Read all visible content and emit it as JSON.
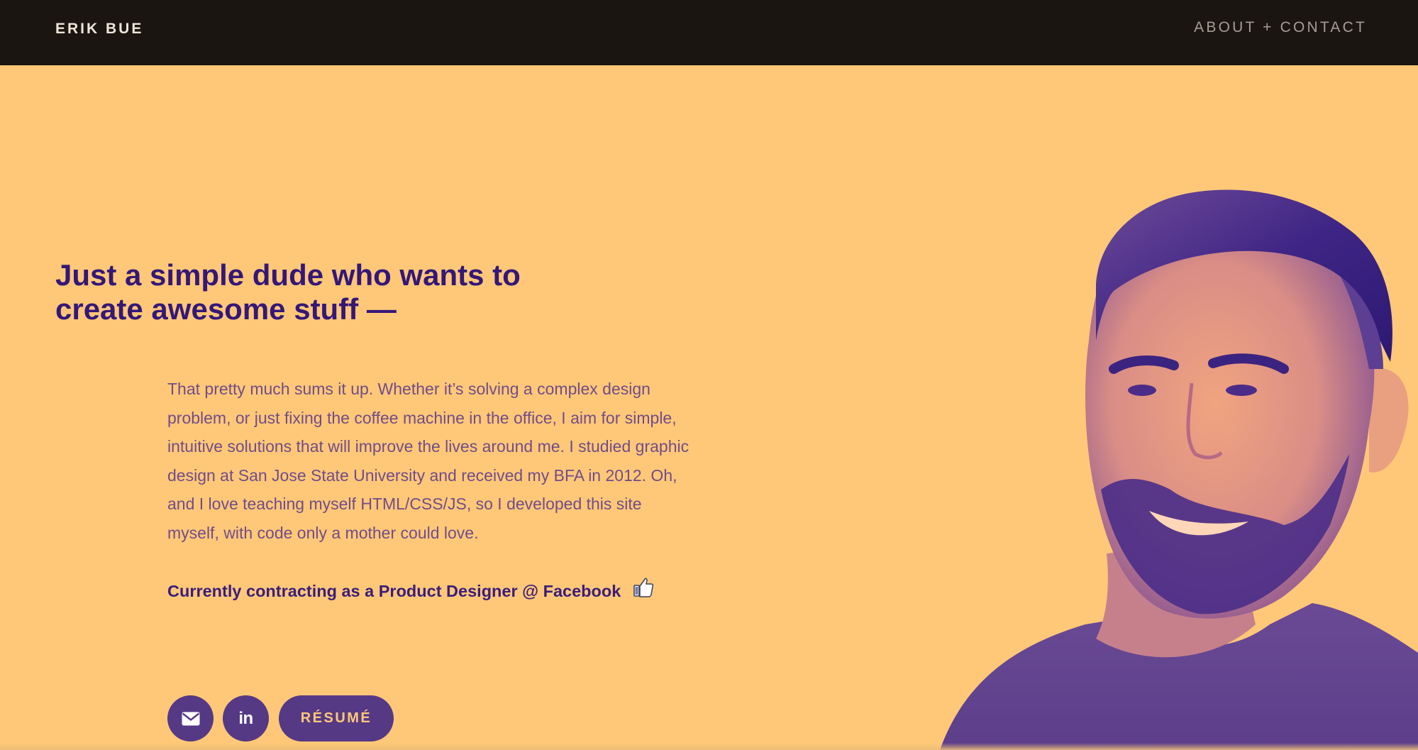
{
  "header": {
    "brand": "ERIK BUE",
    "nav_link": "ABOUT + CONTACT"
  },
  "hero": {
    "headline_line1": "Just a simple dude who wants to",
    "headline_line2": "create awesome stuff —",
    "bio": "That pretty much sums it up. Whether it’s solving a complex design problem, or just fixing the coffee machine in the office, I aim for simple, intuitive solutions that will improve the lives around me. I studied graphic design at San Jose State University and received my BFA in 2012. Oh, and I love teaching myself HTML/CSS/JS, so I developed this site myself, with code only a mother could love.",
    "status": "Currently contracting as a Product Designer @ Facebook",
    "status_icon": "thumbs-up-icon"
  },
  "actions": {
    "email_icon": "envelope-icon",
    "linkedin_icon": "linkedin-icon",
    "linkedin_glyph": "in",
    "resume_label": "RÉSUMÉ"
  },
  "colors": {
    "header_bg": "#1a1510",
    "hero_bg": "#fec878",
    "headline": "#351778",
    "body_text": "#724c88",
    "button_bg": "#563985",
    "button_text": "#fec878"
  }
}
